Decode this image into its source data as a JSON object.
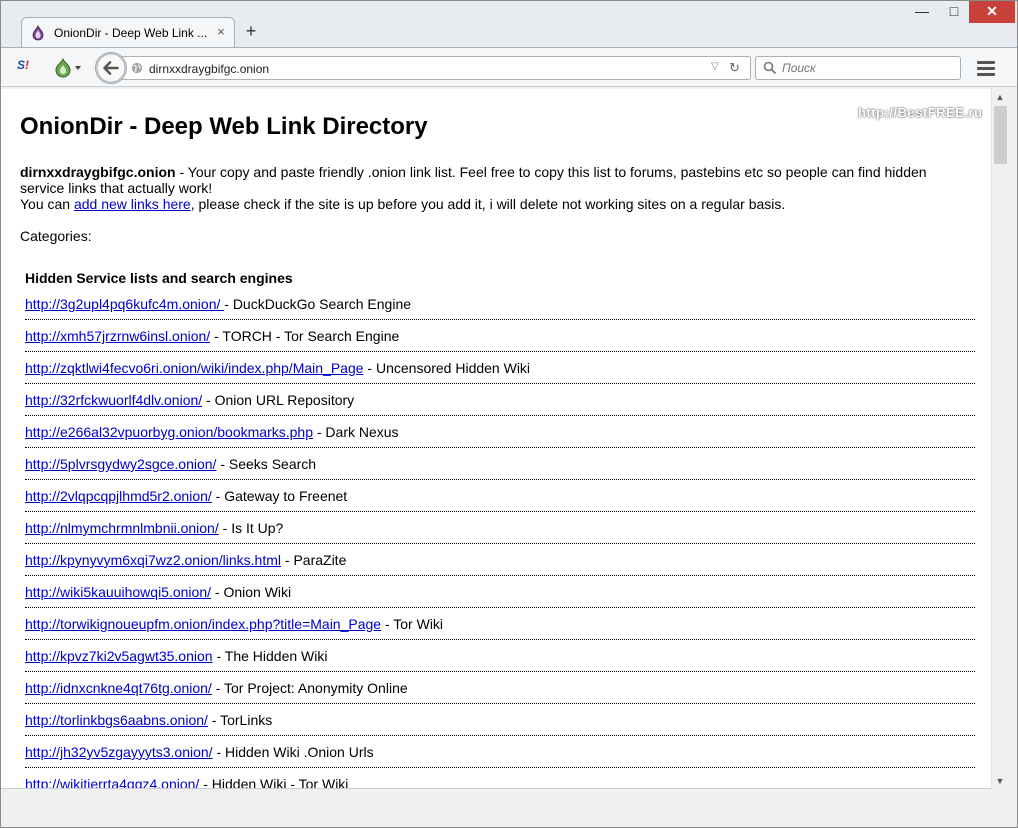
{
  "browser": {
    "tab_title": "OnionDir - Deep Web Link ...",
    "tab_close": "×",
    "new_tab": "+",
    "url": "dirnxxdraygbifgc.onion",
    "search_placeholder": "Поиск",
    "window_controls": {
      "minimize": "—",
      "maximize": "□",
      "close": "✕"
    },
    "icons": [
      "tor-onion-icon",
      "sj-addon-icon",
      "back-arrow-icon",
      "globe-icon",
      "reload-icon",
      "search-icon",
      "hamburger-menu-icon"
    ]
  },
  "page": {
    "title": "OnionDir - Deep Web Link Directory",
    "watermark": "http://BestFREE.ru",
    "intro_site": "dirnxxdraygbifgc.onion",
    "intro_text": " - Your copy and paste friendly .onion link list. Feel free to copy this list to forums, pastebins etc so people can find hidden service links that actually work!",
    "intro_line2_pre": "You can ",
    "intro_link": "add new links here",
    "intro_line2_post": ", please check if the site is up before you add it, i will delete not working sites on a regular basis.",
    "categories_label": "Categories:",
    "section_title": "Hidden Service lists and search engines",
    "links": [
      {
        "url": "http://3g2upl4pq6kufc4m.onion/ ",
        "desc": " - DuckDuckGo Search Engine"
      },
      {
        "url": "http://xmh57jrzrnw6insl.onion/",
        "desc": " - TORCH - Tor Search Engine"
      },
      {
        "url": "http://zqktlwi4fecvo6ri.onion/wiki/index.php/Main_Page",
        "desc": " - Uncensored Hidden Wiki"
      },
      {
        "url": "http://32rfckwuorlf4dlv.onion/",
        "desc": " - Onion URL Repository"
      },
      {
        "url": "http://e266al32vpuorbyg.onion/bookmarks.php",
        "desc": " - Dark Nexus"
      },
      {
        "url": "http://5plvrsgydwy2sgce.onion/",
        "desc": " - Seeks Search"
      },
      {
        "url": "http://2vlqpcqpjlhmd5r2.onion/",
        "desc": " - Gateway to Freenet"
      },
      {
        "url": "http://nlmymchrmnlmbnii.onion/",
        "desc": " - Is It Up?"
      },
      {
        "url": "http://kpynyvym6xqi7wz2.onion/links.html",
        "desc": " - ParaZite"
      },
      {
        "url": "http://wiki5kauuihowqi5.onion/",
        "desc": " - Onion Wiki"
      },
      {
        "url": "http://torwikignoueupfm.onion/index.php?title=Main_Page",
        "desc": " - Tor Wiki"
      },
      {
        "url": "http://kpvz7ki2v5agwt35.onion",
        "desc": " - The Hidden Wiki"
      },
      {
        "url": "http://idnxcnkne4qt76tg.onion/",
        "desc": " - Tor Project: Anonymity Online"
      },
      {
        "url": "http://torlinkbgs6aabns.onion/",
        "desc": " - TorLinks"
      },
      {
        "url": "http://jh32yv5zgayyyts3.onion/",
        "desc": " - Hidden Wiki .Onion Urls"
      },
      {
        "url": "http://wikitjerrta4qgz4.onion/",
        "desc": " - Hidden Wiki - Tor Wiki"
      }
    ]
  }
}
